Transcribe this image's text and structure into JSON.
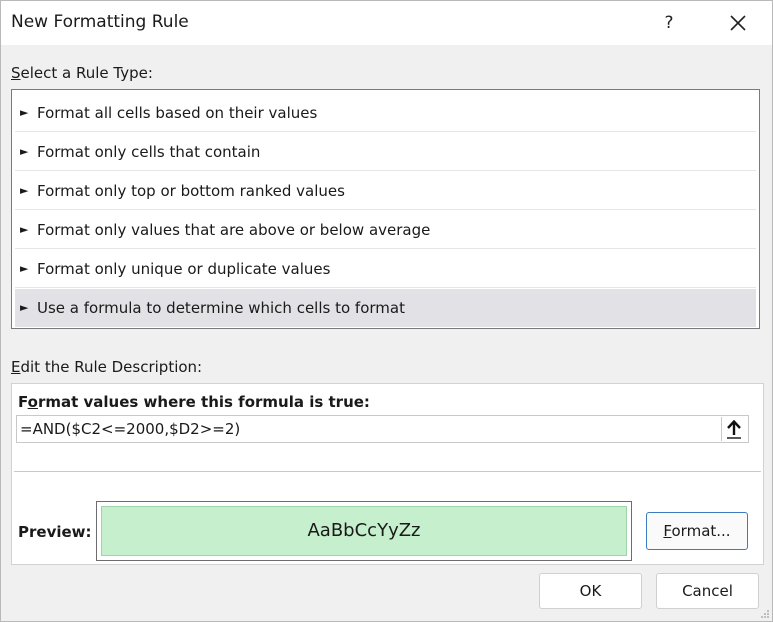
{
  "dialog": {
    "title": "New Formatting Rule",
    "help_label": "?"
  },
  "rule_type": {
    "heading_prefix": "S",
    "heading_rest": "elect a Rule Type:",
    "items": [
      {
        "label": "Format all cells based on their values"
      },
      {
        "label": "Format only cells that contain"
      },
      {
        "label": "Format only top or bottom ranked values"
      },
      {
        "label": "Format only values that are above or below average"
      },
      {
        "label": "Format only unique or duplicate values"
      },
      {
        "label": "Use a formula to determine which cells to format"
      }
    ],
    "selected_index": 5
  },
  "description": {
    "heading_prefix": "E",
    "heading_rest": "dit the Rule Description:",
    "formula_heading_a": "F",
    "formula_heading_u": "o",
    "formula_heading_b": "rmat values where this formula is true:",
    "formula_value": "=AND($C2<=2000,$D2>=2)",
    "preview_label": "Preview:",
    "preview_text": "AaBbCcYyZz",
    "preview_fill": "#c6efce",
    "format_button_prefix": "F",
    "format_button_rest": "ormat..."
  },
  "footer": {
    "ok_label": "OK",
    "cancel_label": "Cancel"
  }
}
